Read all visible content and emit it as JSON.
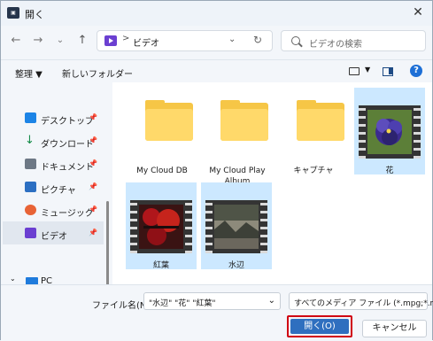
{
  "window": {
    "title": "開く"
  },
  "navigation": {
    "breadcrumb_separator": ">",
    "current_folder": "ビデオ",
    "search_placeholder": "ビデオの検索"
  },
  "toolbar": {
    "organize_label": "整理 ▼",
    "new_folder_label": "新しいフォルダー"
  },
  "sidebar": {
    "items": [
      {
        "label": "デスクトップ",
        "icon": "desktop-icon"
      },
      {
        "label": "ダウンロード",
        "icon": "download-icon"
      },
      {
        "label": "ドキュメント",
        "icon": "document-icon"
      },
      {
        "label": "ピクチャ",
        "icon": "pictures-icon"
      },
      {
        "label": "ミュージック",
        "icon": "music-icon"
      },
      {
        "label": "ビデオ",
        "icon": "video-folder-icon"
      }
    ],
    "pc_label": "PC"
  },
  "files": [
    {
      "name": "My Cloud DB",
      "type": "folder"
    },
    {
      "name": "My Cloud Play Album",
      "type": "folder"
    },
    {
      "name": "キャプチャ",
      "type": "folder"
    },
    {
      "name": "花",
      "type": "video"
    },
    {
      "name": "紅葉",
      "type": "video"
    },
    {
      "name": "水辺",
      "type": "video"
    }
  ],
  "dialog": {
    "filename_label": "ファイル名(N):",
    "filename_value": "\"水辺\" \"花\" \"紅葉\"",
    "filetype_value": "すべてのメディア ファイル (*.mpg;*.m",
    "open_button": "開く(O)",
    "cancel_button": "キャンセル"
  },
  "colors": {
    "accent": "#2f6fbf",
    "selection": "#cce8ff",
    "highlight": "#d00012"
  }
}
